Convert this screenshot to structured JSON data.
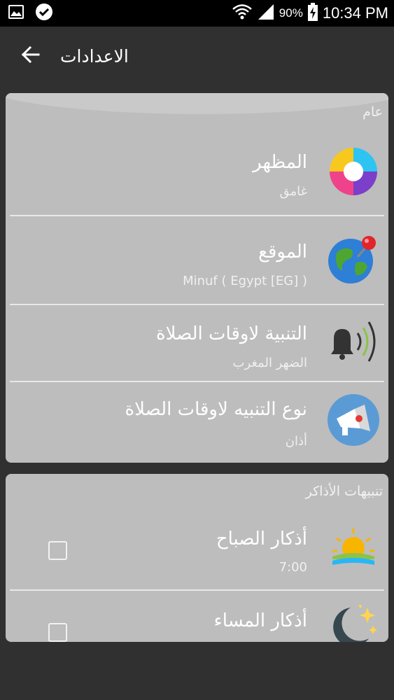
{
  "status_bar": {
    "battery_percent": "90%",
    "time": "10:34 PM",
    "left_icons": [
      "gallery-icon",
      "check-circle-icon"
    ],
    "right_icons": [
      "wifi-icon",
      "signal-icon",
      "battery-charging-icon"
    ]
  },
  "toolbar": {
    "title": "الاعدادات",
    "back_icon": "arrow-back-icon"
  },
  "sections": [
    {
      "title": "عام",
      "rows": [
        {
          "title": "المظهر",
          "subtitle": "غامق",
          "icon": "theme-icon"
        },
        {
          "title": "الموقع",
          "subtitle": "Minuf ( Egypt [EG] )",
          "icon": "globe-pin-icon"
        },
        {
          "title": "التنبية لاوقات الصلاة",
          "subtitle": "الضهر  المغرب",
          "icon": "bell-icon"
        },
        {
          "title": "نوع التنبيه لاوقات الصلاة",
          "subtitle": "أذان",
          "icon": "megaphone-icon"
        }
      ]
    },
    {
      "title": "تنبيهات الأذاكر",
      "rows": [
        {
          "title": "أذكار الصباح",
          "subtitle": "7:00",
          "icon": "sunrise-icon",
          "checked": false
        },
        {
          "title": "أذكار المساء",
          "subtitle": "",
          "icon": "moon-stars-icon",
          "checked": false
        }
      ]
    }
  ],
  "colors": {
    "background": "#303030",
    "card": "#bdbdbd",
    "text": "#ffffff"
  }
}
